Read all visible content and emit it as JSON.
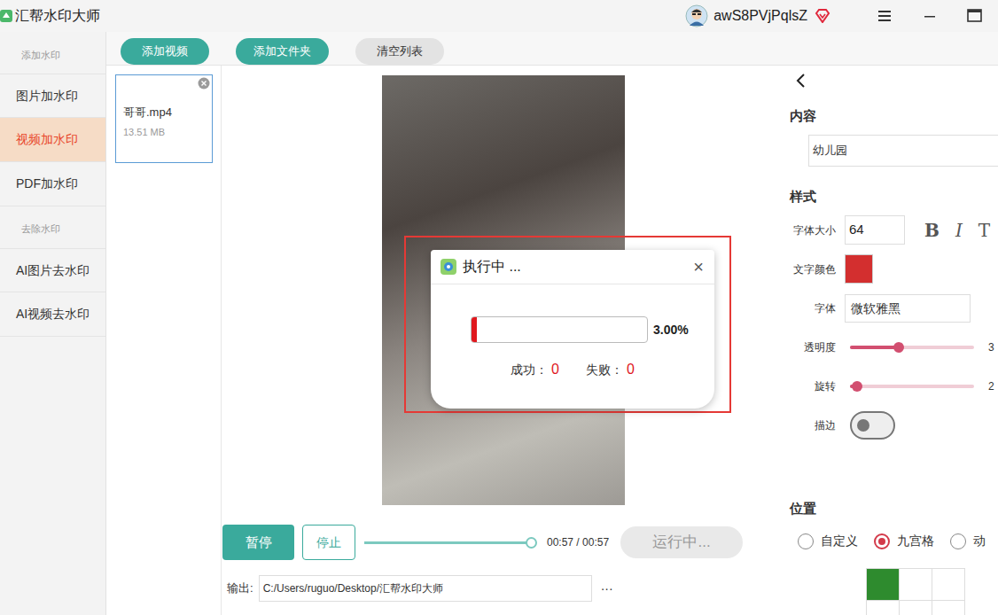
{
  "window": {
    "title": "汇帮水印大师",
    "user": "awS8PVjPqlsZ"
  },
  "sidebar": {
    "sections": [
      {
        "label": "添加水印",
        "items": [
          {
            "label": "图片加水印",
            "selected": false
          },
          {
            "label": "视频加水印",
            "selected": true
          },
          {
            "label": "PDF加水印",
            "selected": false
          }
        ]
      },
      {
        "label": "去除水印",
        "items": [
          {
            "label": "AI图片去水印",
            "selected": false
          },
          {
            "label": "AI视频去水印",
            "selected": false
          }
        ]
      }
    ]
  },
  "toolbar": {
    "buttons": [
      {
        "label": "添加视频",
        "kind": "primary"
      },
      {
        "label": "添加文件夹",
        "kind": "primary"
      },
      {
        "label": "清空列表",
        "kind": "secondary"
      }
    ]
  },
  "files": [
    {
      "name": "哥哥.mp4",
      "size": "13.51 MB",
      "selected": true
    }
  ],
  "player": {
    "pause": "暂停",
    "stop": "停止",
    "level": 1,
    "time": "00:57 / 00:57",
    "run": {
      "label": "运行中...",
      "disabled": true
    }
  },
  "output": {
    "label": "输出:",
    "path": "C:/Users/ruguo/Desktop/汇帮水印大师",
    "more": "···"
  },
  "settings": {
    "content": {
      "heading": "内容",
      "value": "幼儿园"
    },
    "style": {
      "heading": "样式",
      "font_size_label": "字体大小",
      "font_size": "64",
      "format_buttons": [
        "B",
        "I",
        "T"
      ],
      "color_label": "文字颜色",
      "color": "#d32f2f",
      "font_label": "字体",
      "font": "微软雅黑",
      "sliders": [
        {
          "label": "透明度",
          "level": 0.39,
          "reading": "3"
        },
        {
          "label": "旋转",
          "level": 0.06,
          "reading": "2"
        }
      ],
      "stroke": {
        "label": "描边",
        "on": false
      }
    },
    "position": {
      "heading": "位置",
      "options": [
        {
          "label": "自定义",
          "selected": false
        },
        {
          "label": "九宫格",
          "selected": true
        },
        {
          "label": "动",
          "selected": false
        }
      ],
      "grid": [
        {
          "selected": true
        },
        {
          "selected": false
        },
        {
          "selected": false
        },
        {
          "selected": false
        },
        {
          "selected": false
        },
        {
          "selected": false
        }
      ]
    }
  },
  "dialog": {
    "title": "执行中 ...",
    "close": "×",
    "level": 0.03,
    "percent": "3.00%",
    "success_label": "成功：",
    "success": "0",
    "fail_label": "失败：",
    "fail": "0"
  }
}
